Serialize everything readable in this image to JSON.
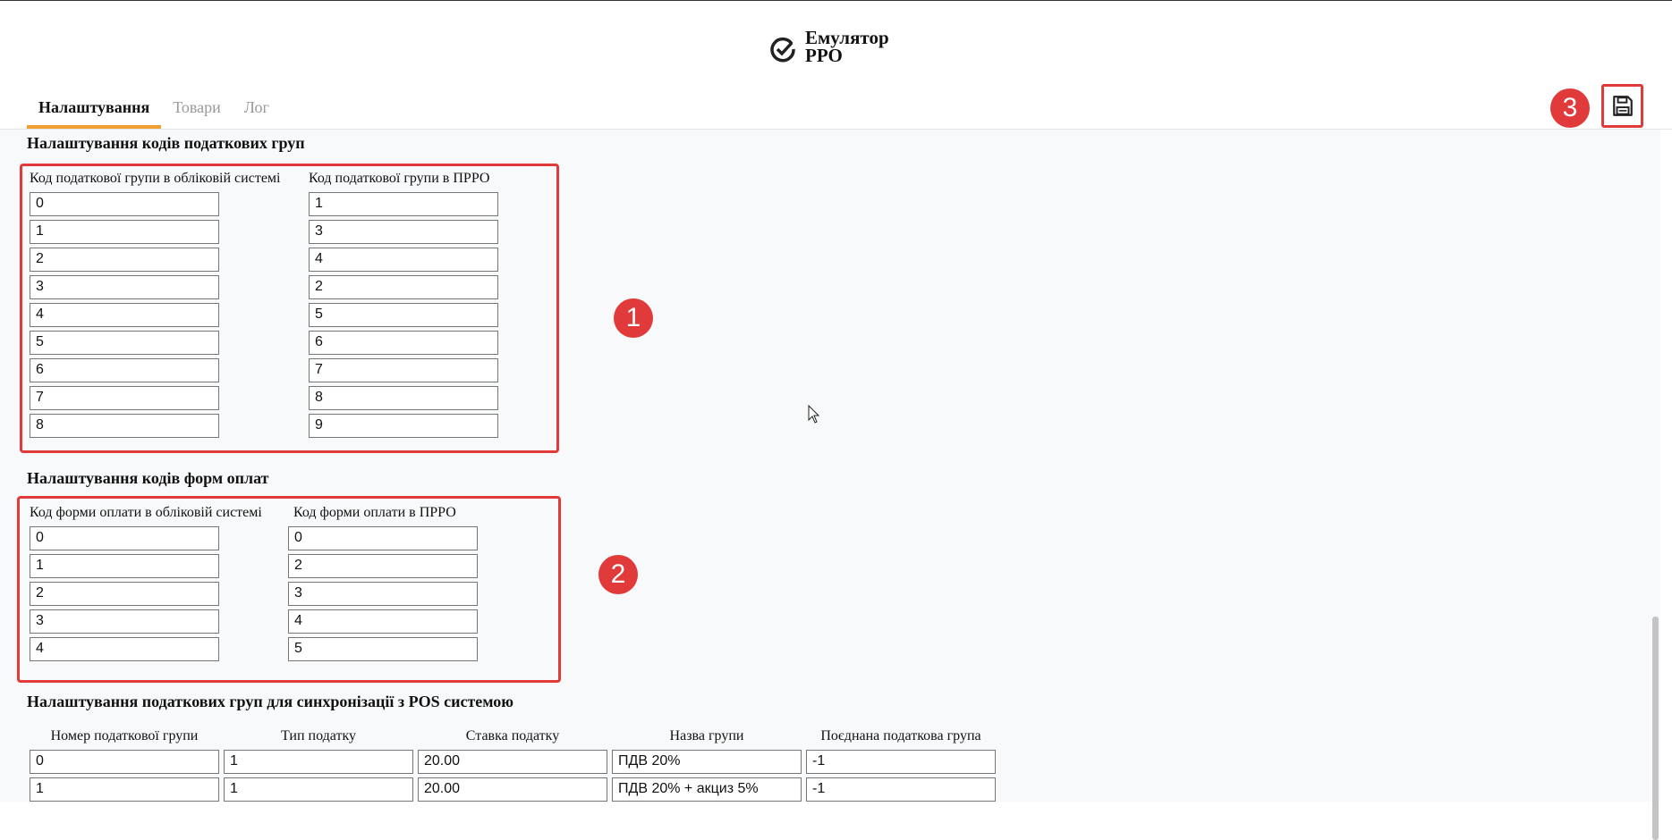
{
  "app": {
    "title_line1": "Емулятор",
    "title_line2": "РРО"
  },
  "tabs": [
    {
      "label": "Налаштування",
      "active": true
    },
    {
      "label": "Товари",
      "active": false
    },
    {
      "label": "Лог",
      "active": false
    }
  ],
  "badges": {
    "one": "1",
    "two": "2",
    "three": "3"
  },
  "tax_groups": {
    "title": "Налаштування кодів податкових груп",
    "col1_label": "Код податкової групи в обліковій системі",
    "col2_label": "Код податкової групи в ПРРО",
    "rows": [
      {
        "a": "0",
        "b": "1"
      },
      {
        "a": "1",
        "b": "3"
      },
      {
        "a": "2",
        "b": "4"
      },
      {
        "a": "3",
        "b": "2"
      },
      {
        "a": "4",
        "b": "5"
      },
      {
        "a": "5",
        "b": "6"
      },
      {
        "a": "6",
        "b": "7"
      },
      {
        "a": "7",
        "b": "8"
      },
      {
        "a": "8",
        "b": "9"
      }
    ]
  },
  "payments": {
    "title": "Налаштування кодів форм оплат",
    "col1_label": "Код форми оплати в обліковій системі",
    "col2_label": "Код форми оплати в ПРРО",
    "rows": [
      {
        "a": "0",
        "b": "0"
      },
      {
        "a": "1",
        "b": "2"
      },
      {
        "a": "2",
        "b": "3"
      },
      {
        "a": "3",
        "b": "4"
      },
      {
        "a": "4",
        "b": "5"
      }
    ]
  },
  "pos_sync": {
    "title": "Налаштування податкових груп для синхронізації з POS системою",
    "headers": [
      "Номер податкової групи",
      "Тип податку",
      "Ставка податку",
      "Назва групи",
      "Поєднана податкова група"
    ],
    "rows": [
      [
        "0",
        "1",
        "20.00",
        "ПДВ 20%",
        "-1"
      ],
      [
        "1",
        "1",
        "20.00",
        "ПДВ 20% + акциз 5%",
        "-1"
      ]
    ]
  },
  "colors": {
    "accent": "#f0a030",
    "highlight": "#e03a3a"
  },
  "icons": {
    "logo": "check-circle-icon",
    "save": "floppy-disk-icon",
    "pointer": "mouse-cursor-icon"
  }
}
